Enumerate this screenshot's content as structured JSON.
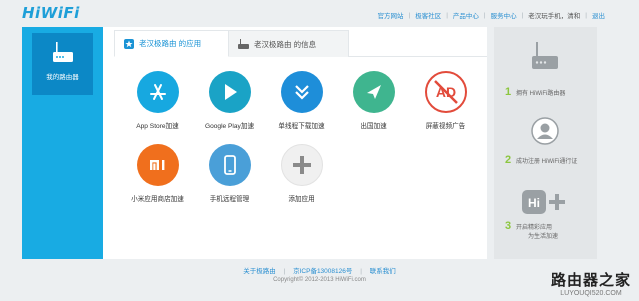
{
  "brand": {
    "logo": "HiWiFi"
  },
  "topnav": {
    "links": [
      "官方网站",
      "极客社区",
      "产品中心",
      "服务中心"
    ],
    "user": "老汉玩手机，清和",
    "logout": "退出"
  },
  "sidebar": {
    "item_label": "我的路由器"
  },
  "tabs": [
    {
      "label": "老汉极路由 的应用"
    },
    {
      "label": "老汉极路由 的信息"
    }
  ],
  "apps": [
    {
      "name": "App Store加速",
      "icon": "app-store-icon",
      "color": "#17a8e0"
    },
    {
      "name": "Google Play加速",
      "icon": "google-play-icon",
      "color": "#1aa3c6"
    },
    {
      "name": "单线程下载加速",
      "icon": "download-accelerate-icon",
      "color": "#1e8ed9"
    },
    {
      "name": "出国加速",
      "icon": "plane-icon",
      "color": "#3fb58f"
    },
    {
      "name": "屏蔽视频广告",
      "icon": "ad-block-icon",
      "color": "#ffffff"
    },
    {
      "name": "小米应用商店加速",
      "icon": "mi-store-icon",
      "color": "#f06f1d"
    },
    {
      "name": "手机远程管理",
      "icon": "phone-icon",
      "color": "#4a9fd8"
    },
    {
      "name": "添加应用",
      "icon": "add-icon",
      "color": "#f0f0f0"
    }
  ],
  "steps": [
    {
      "num": "1",
      "text": "拥有 HiWiFi路由器"
    },
    {
      "num": "2",
      "text": "成功注册 HiWiFi通行证"
    },
    {
      "num": "3",
      "text": "开启精彩应用",
      "text2": "为生活加速"
    }
  ],
  "footer": {
    "links": [
      "关于极路由",
      "京ICP备13008126号",
      "联系我们"
    ],
    "copyright": "Copyright© 2012-2013 HiWiFi.com"
  },
  "watermark": {
    "title": "路由器之家",
    "url": "LUYOUQI520.COM"
  }
}
